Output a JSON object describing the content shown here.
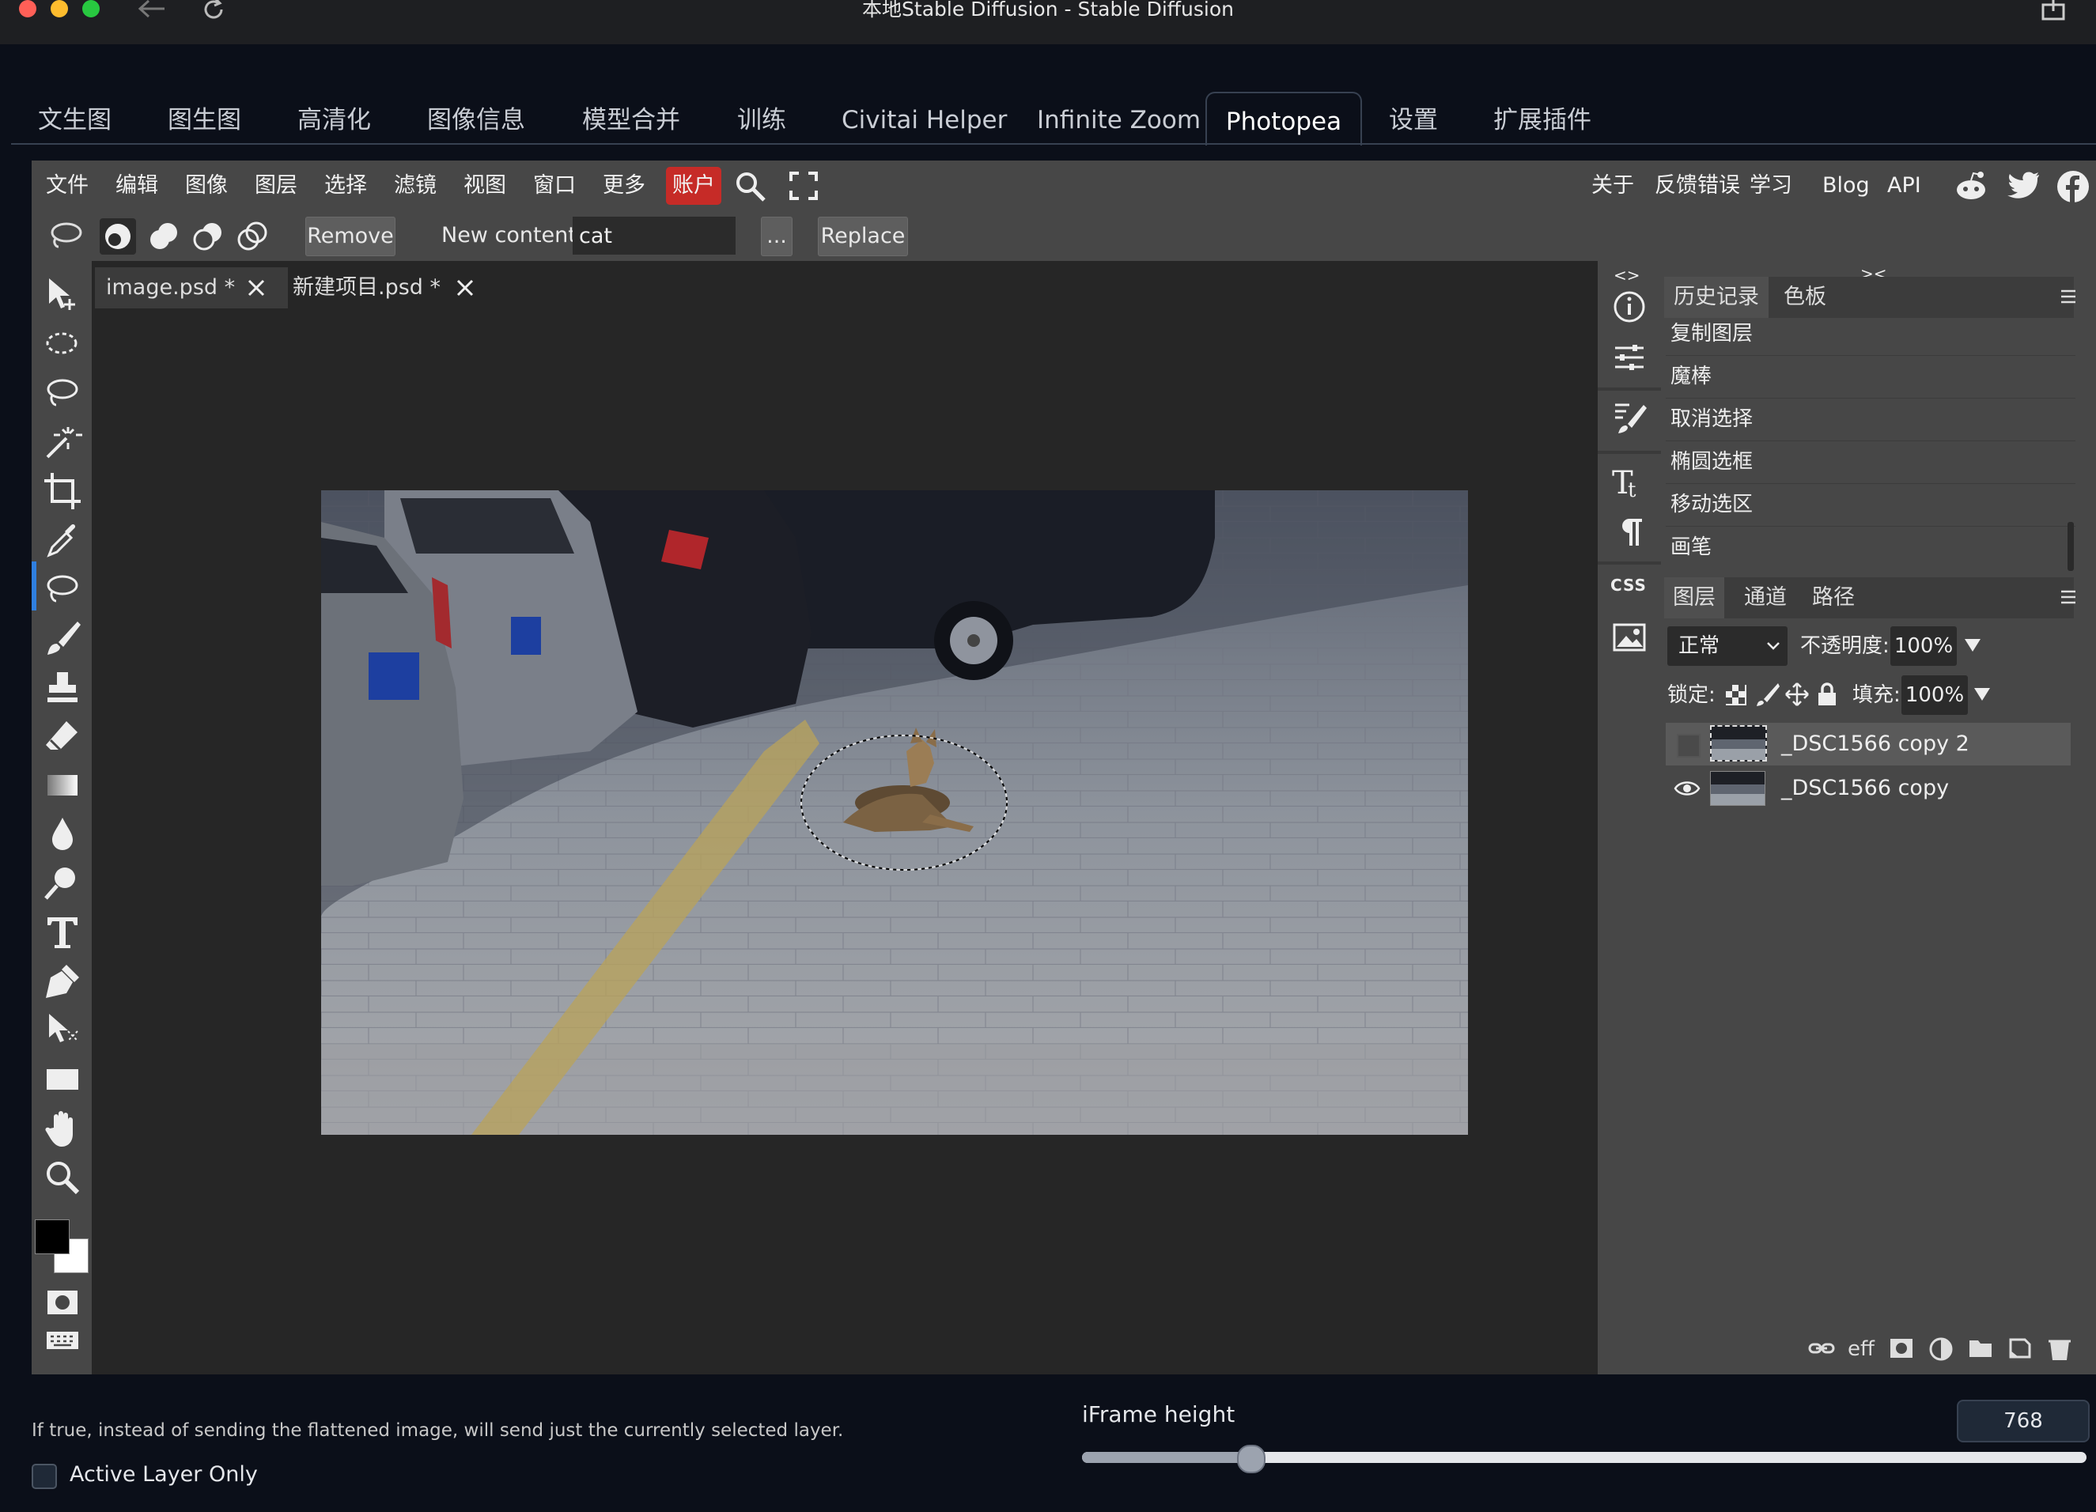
{
  "window": {
    "title": "本地Stable Diffusion - Stable Diffusion"
  },
  "main_tabs": [
    {
      "label": "文生图"
    },
    {
      "label": "图生图"
    },
    {
      "label": "高清化"
    },
    {
      "label": "图像信息"
    },
    {
      "label": "模型合并"
    },
    {
      "label": "训练"
    },
    {
      "label": "Civitai Helper"
    },
    {
      "label": "Infinite Zoom"
    },
    {
      "label": "Photopea",
      "active": true
    },
    {
      "label": "设置"
    },
    {
      "label": "扩展插件"
    }
  ],
  "photopea": {
    "menu": [
      "文件",
      "编辑",
      "图像",
      "图层",
      "选择",
      "滤镜",
      "视图",
      "窗口",
      "更多"
    ],
    "account": "账户",
    "right_menu": [
      "关于",
      "反馈错误",
      "学习",
      "Blog",
      "API"
    ],
    "options": {
      "remove_label": "Remove",
      "new_content_label": "New content:",
      "new_content_value": "cat",
      "more_label": "...",
      "replace_label": "Replace"
    },
    "doc_tabs": [
      {
        "label": "image.psd *"
      },
      {
        "label": "新建项目.psd *"
      }
    ],
    "panel_collapse": {
      "left": "<>",
      "right": "><"
    },
    "history_tabs": [
      "历史记录",
      "色板"
    ],
    "history": [
      "复制图层",
      "魔棒",
      "取消选择",
      "椭圆选框",
      "移动选区",
      "画笔"
    ],
    "layers_tabs": [
      "图层",
      "通道",
      "路径"
    ],
    "blend_mode": "正常",
    "opacity_label": "不透明度:",
    "opacity_value": "100%",
    "lock_label": "锁定:",
    "fill_label": "填充:",
    "fill_value": "100%",
    "layers": [
      {
        "name": "_DSC1566 copy 2",
        "visible": false,
        "selected": true
      },
      {
        "name": "_DSC1566 copy",
        "visible": true,
        "selected": false
      }
    ],
    "css_label": "CSS"
  },
  "bottom": {
    "hint": "If true, instead of sending the flattened image, will send just the currently selected layer.",
    "active_layer_label": "Active Layer Only",
    "iframe_label": "iFrame height",
    "iframe_value": "768",
    "iframe_slider_fraction": 0.167
  },
  "colors": {
    "accent_red": "#c62b27",
    "app_bg": "#0b0f19",
    "panel_bg": "#474747",
    "workspace_bg": "#262626"
  }
}
